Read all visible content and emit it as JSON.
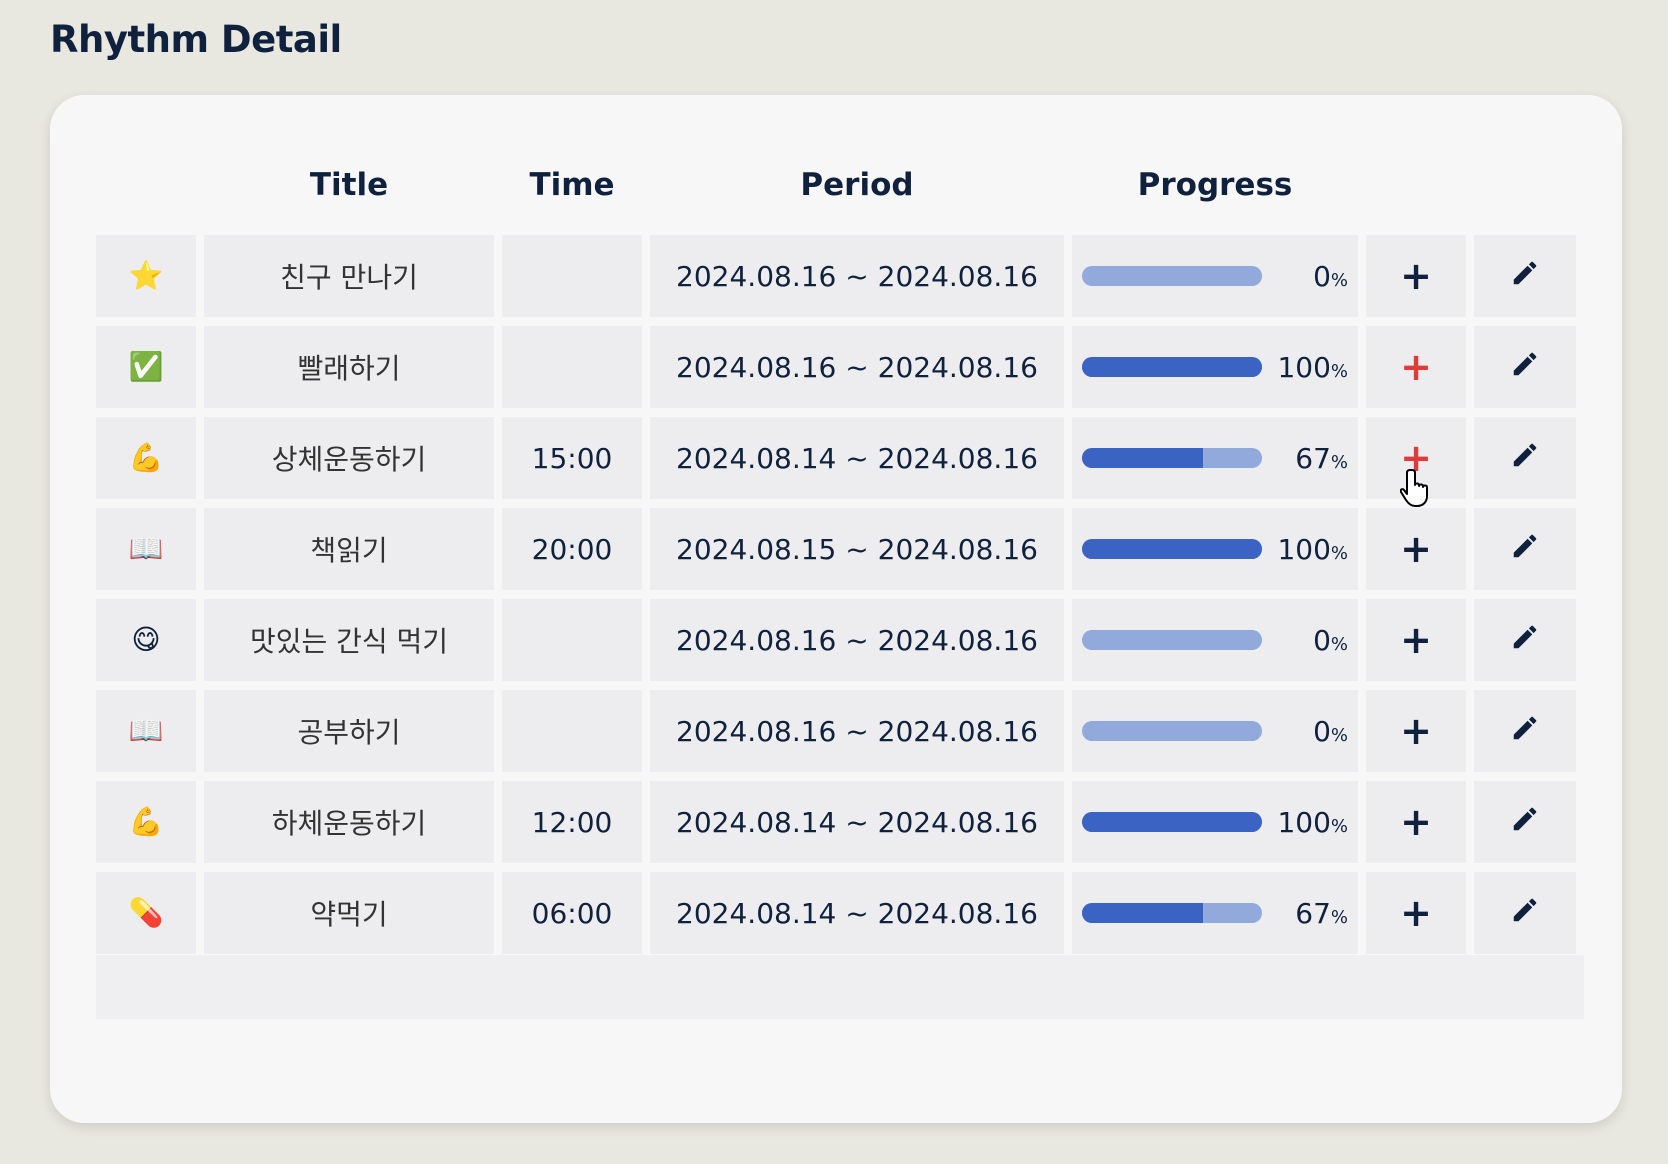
{
  "page": {
    "title": "Rhythm Detail"
  },
  "columns": {
    "title": "Title",
    "time": "Time",
    "period": "Period",
    "progress": "Progress"
  },
  "colors": {
    "bar_track": "#91a9db",
    "bar_fill": "#3a63c4",
    "add_active": "#e03b3b"
  },
  "rows": [
    {
      "icon": "⭐",
      "icon_name": "star-icon",
      "title": "친구 만나기",
      "time": "",
      "period": "2024.08.16 ~ 2024.08.16",
      "progress": 0,
      "progress_label": "0",
      "add_active": false
    },
    {
      "icon": "✅",
      "icon_name": "check-icon",
      "title": "빨래하기",
      "time": "",
      "period": "2024.08.16 ~ 2024.08.16",
      "progress": 100,
      "progress_label": "100",
      "add_active": true
    },
    {
      "icon": "💪",
      "icon_name": "muscle-icon",
      "title": "상체운동하기",
      "time": "15:00",
      "period": "2024.08.14 ~ 2024.08.16",
      "progress": 67,
      "progress_label": "67",
      "add_active": true
    },
    {
      "icon": "📖",
      "icon_name": "book-icon",
      "title": "책읽기",
      "time": "20:00",
      "period": "2024.08.15 ~ 2024.08.16",
      "progress": 100,
      "progress_label": "100",
      "add_active": false
    },
    {
      "icon": "😋",
      "icon_name": "yum-face-icon",
      "title": "맛있는 간식 먹기",
      "time": "",
      "period": "2024.08.16 ~ 2024.08.16",
      "progress": 0,
      "progress_label": "0",
      "add_active": false
    },
    {
      "icon": "📖",
      "icon_name": "book-icon",
      "title": "공부하기",
      "time": "",
      "period": "2024.08.16 ~ 2024.08.16",
      "progress": 0,
      "progress_label": "0",
      "add_active": false
    },
    {
      "icon": "💪",
      "icon_name": "muscle-icon",
      "title": "하체운동하기",
      "time": "12:00",
      "period": "2024.08.14 ~ 2024.08.16",
      "progress": 100,
      "progress_label": "100",
      "add_active": false
    },
    {
      "icon": "💊",
      "icon_name": "pill-icon",
      "title": "약먹기",
      "time": "06:00",
      "period": "2024.08.14 ~ 2024.08.16",
      "progress": 67,
      "progress_label": "67",
      "add_active": false
    }
  ],
  "labels": {
    "percent_sign": "%",
    "add_symbol": "+"
  }
}
